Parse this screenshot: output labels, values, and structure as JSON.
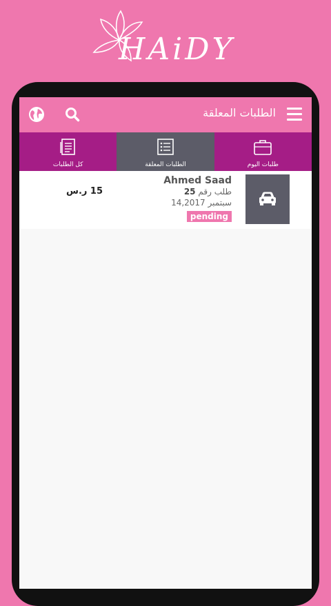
{
  "brand": {
    "name": "HAiDY"
  },
  "appbar": {
    "title": "الطلبات المعلقة",
    "icons": [
      "menu-icon",
      "search-icon",
      "globe-icon"
    ]
  },
  "tabs": [
    {
      "label": "طلبات اليوم",
      "icon": "briefcase-icon",
      "active": false
    },
    {
      "label": "الطلبات المعلقة",
      "icon": "list-icon",
      "active": true
    },
    {
      "label": "كل الطلبات",
      "icon": "document-icon",
      "active": false
    }
  ],
  "orders": [
    {
      "customer": "Ahmed Saad",
      "order_label": "طلب رقم",
      "order_number": "25",
      "date_month": "سبتمبر",
      "date_rest": "14,2017",
      "status": "pending",
      "price": "15",
      "currency": "ر.س",
      "icon": "car-icon"
    }
  ],
  "colors": {
    "pink": "#ef77ae",
    "purple": "#a51d86",
    "gray": "#5c5c68"
  }
}
